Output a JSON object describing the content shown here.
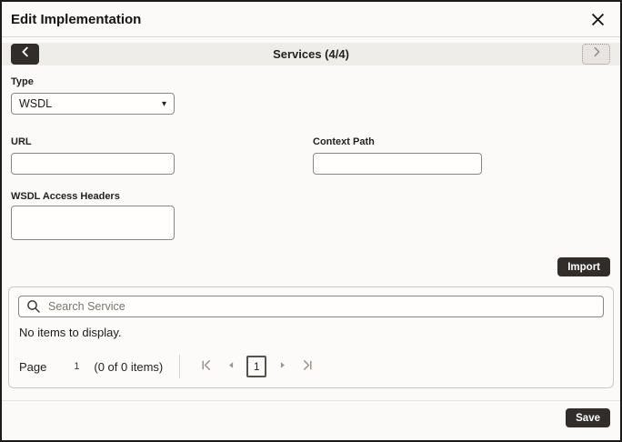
{
  "dialog": {
    "title": "Edit Implementation"
  },
  "nav": {
    "title": "Services  (4/4)"
  },
  "form": {
    "type": {
      "label": "Type",
      "value": "WSDL",
      "input_value": ""
    },
    "url": {
      "label": "URL",
      "value": ""
    },
    "context_path": {
      "label": "Context Path",
      "value": ""
    },
    "wsdl_access_headers": {
      "label": "WSDL Access Headers",
      "value": ""
    }
  },
  "actions": {
    "import_label": "Import",
    "save_label": "Save"
  },
  "service_panel": {
    "search_placeholder": "Search Service",
    "empty_message": "No items to display.",
    "pagination": {
      "page_label": "Page",
      "page_value": "1",
      "items_summary": "(0 of 0 items)",
      "current_page": "1"
    }
  },
  "icons": {
    "close": "✕",
    "back_chevron": "‹",
    "forward_chevron": "›",
    "search": "🔍",
    "select_caret": "▾",
    "first_page": "|◂",
    "previous_page": "◂",
    "next_page": "▸",
    "last_page": "▸|"
  },
  "colors": {
    "accent_dark": "#312d2a",
    "navbar_bg": "#efedea",
    "page_bg": "#fbfaf8",
    "field_border": "#8c8680",
    "panel_border": "#ccc8c3",
    "icon_gray": "#9a948d",
    "text_dark": "#1c1a17"
  }
}
